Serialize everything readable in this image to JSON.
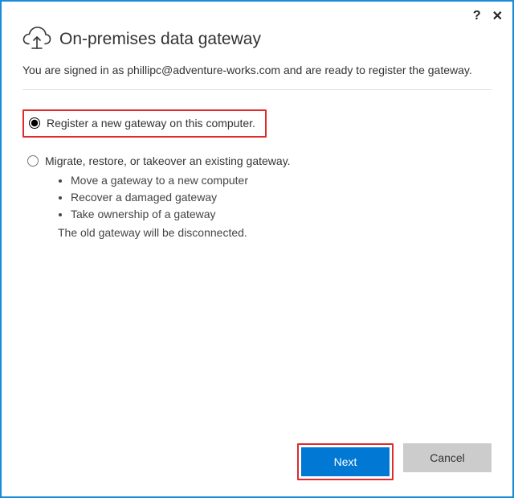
{
  "titlebar": {
    "help_label": "?",
    "close_label": "✕"
  },
  "header": {
    "title": "On-premises data gateway",
    "subtitle_prefix": "You are signed in as ",
    "user_email": "phillipc@adventure-works.com",
    "subtitle_suffix": " and are ready to register the gateway."
  },
  "options": {
    "register": {
      "label": "Register a new gateway on this computer.",
      "selected": true
    },
    "migrate": {
      "label": "Migrate, restore, or takeover an existing gateway.",
      "selected": false,
      "bullets": [
        "Move a gateway to a new computer",
        "Recover a damaged gateway",
        "Take ownership of a gateway"
      ],
      "note": "The old gateway will be disconnected."
    }
  },
  "footer": {
    "next_label": "Next",
    "cancel_label": "Cancel"
  }
}
